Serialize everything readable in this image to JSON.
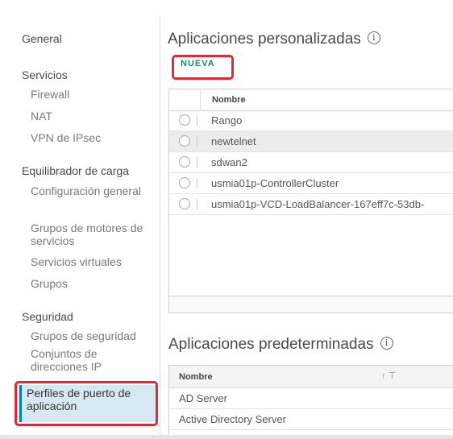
{
  "sidebar": {
    "general": "General",
    "services_heading": "Servicios",
    "services": [
      "Firewall",
      "NAT",
      "VPN de IPsec"
    ],
    "lb_heading": "Equilibrador de carga",
    "lb_items": [
      "Configuración general",
      "Grupos de motores de servicios",
      "Servicios virtuales",
      "Grupos"
    ],
    "security_heading": "Seguridad",
    "security_items": [
      "Grupos de seguridad",
      "Conjuntos de direcciones IP",
      "Perfiles de puerto de aplicación"
    ]
  },
  "custom_apps": {
    "title": "Aplicaciones personalizadas",
    "info_icon": "info-icon",
    "new_label": "NUEVA",
    "column_name": "Nombre",
    "rows": [
      "Rango",
      "newtelnet",
      "sdwan2",
      "usmia01p-ControllerCluster",
      "usmia01p-VCD-LoadBalancer-167eff7c-53db-"
    ]
  },
  "default_apps": {
    "title": "Aplicaciones predeterminadas",
    "info_icon": "info-icon",
    "column_name": "Nombre",
    "sort_icon": "↑ ⊤",
    "rows": [
      "AD Server",
      "Active Directory Server"
    ]
  },
  "colors": {
    "accent": "#0c8a7e",
    "highlight": "#dc2a38",
    "active_bg": "#d8e8f3"
  }
}
